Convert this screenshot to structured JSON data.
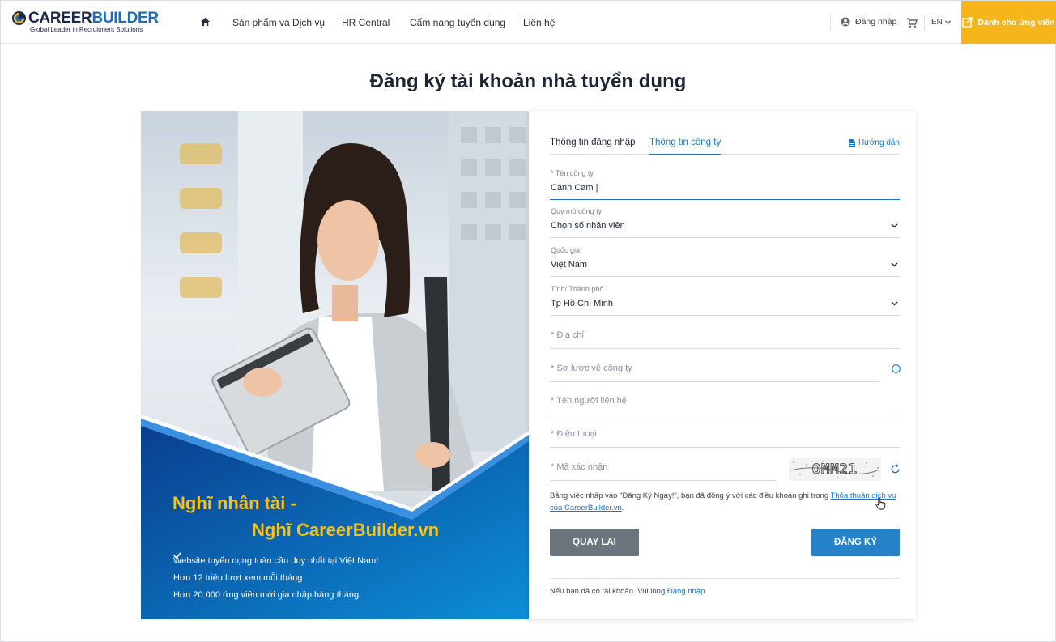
{
  "header": {
    "logo_text_a": "CAREER",
    "logo_text_b": "BUILDER",
    "logo_tagline": "Global Leader in Recruitment Solutions",
    "nav": [
      "Sản phẩm và Dịch vụ",
      "HR Central",
      "Cẩm nang tuyển dụng",
      "Liên hệ"
    ],
    "login": "Đăng nhập",
    "lang": "EN",
    "candidate_button": "Dành cho ứng viên",
    "accent_color": "#f6b51b"
  },
  "page_title": "Đăng ký tài khoản nhà tuyển dụng",
  "hero": {
    "headline_1": "Nghĩ nhân tài -",
    "headline_2": "Nghĩ CareerBuilder.vn",
    "bullets": [
      "Website tuyển dụng toàn cầu duy nhất tại Việt Nam!",
      "Hơn 12 triệu lượt xem mỗi tháng",
      "Hơn 20.000 ứng viên mới gia nhập hàng tháng"
    ]
  },
  "form": {
    "tabs": {
      "login_info": "Thông tin đăng nhập",
      "company_info": "Thông tin công ty"
    },
    "guide": "Hướng dẫn",
    "company_name": {
      "label": "* Tên công ty",
      "value": "Cánh Cam |"
    },
    "company_size": {
      "label": "Quy mô công ty",
      "value": "Chọn số nhân viên"
    },
    "country": {
      "label": "Quốc gia",
      "value": "Việt Nam"
    },
    "city": {
      "label": "Tỉnh/ Thành phố",
      "value": "Tp Hồ Chí Minh"
    },
    "address": {
      "placeholder": "* Địa chỉ"
    },
    "summary": {
      "placeholder": "* Sơ lược về công ty"
    },
    "contact": {
      "placeholder": "* Tên người liên hệ"
    },
    "phone": {
      "placeholder": "* Điện thoại"
    },
    "captcha": {
      "placeholder": "* Mã xác nhận",
      "code": "OMM21"
    },
    "terms_text": "Bằng việc nhấp vào \"Đăng Ký Ngay!\", bạn đã đồng ý với các điều khoản ghi trong ",
    "terms_link": "Thỏa thuận dịch vụ của CareerBuilder.vn",
    "terms_end": ".",
    "back_button": "QUAY LẠI",
    "register_button": "ĐĂNG KÝ",
    "have_account": "Nếu bạn đã có tài khoản. Vui lòng ",
    "login_link": "Đăng nhập"
  }
}
